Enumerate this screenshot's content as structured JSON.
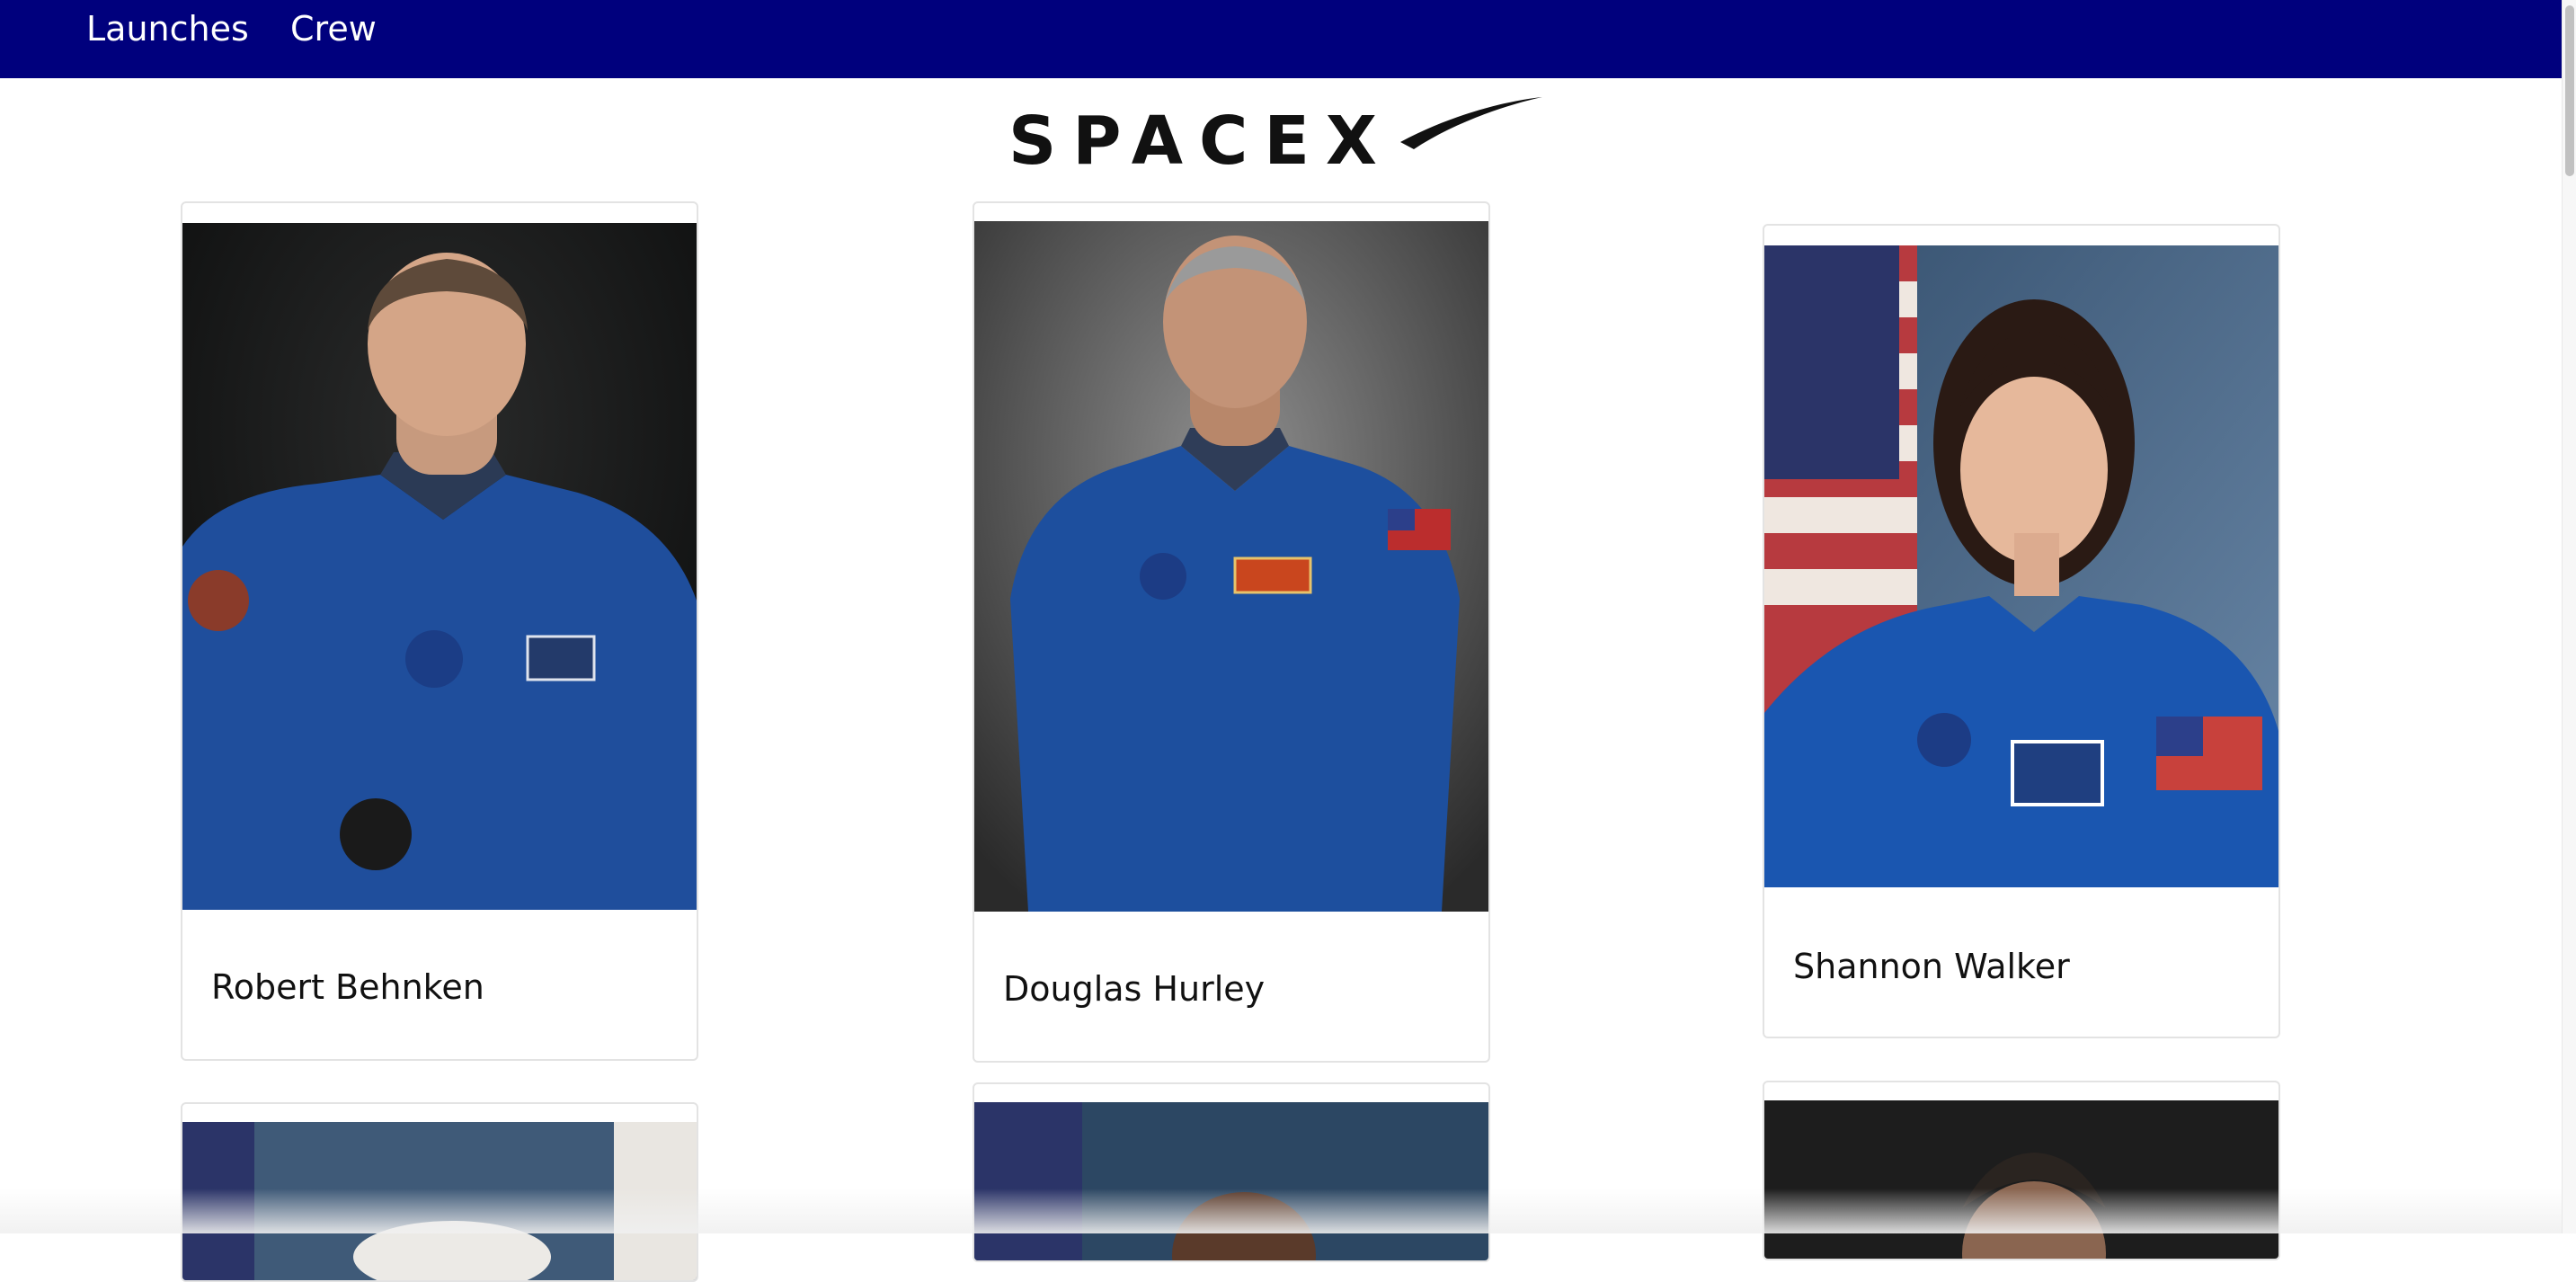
{
  "nav": {
    "links": [
      {
        "label": "Launches"
      },
      {
        "label": "Crew"
      }
    ],
    "bar_color": "#00007d"
  },
  "logo": {
    "text": "SPACEX",
    "icon": "spacex-logo"
  },
  "crew": [
    {
      "name": "Robert Behnken",
      "suit_color": "#1f4e9c",
      "background": "dark"
    },
    {
      "name": "Douglas Hurley",
      "suit_color": "#1d4f9e",
      "background": "grey"
    },
    {
      "name": "Shannon Walker",
      "suit_color": "#1a56b0",
      "background": "flag"
    },
    {
      "name": "",
      "background": "flag"
    },
    {
      "name": "",
      "background": "flag"
    },
    {
      "name": "",
      "background": "dark"
    }
  ]
}
